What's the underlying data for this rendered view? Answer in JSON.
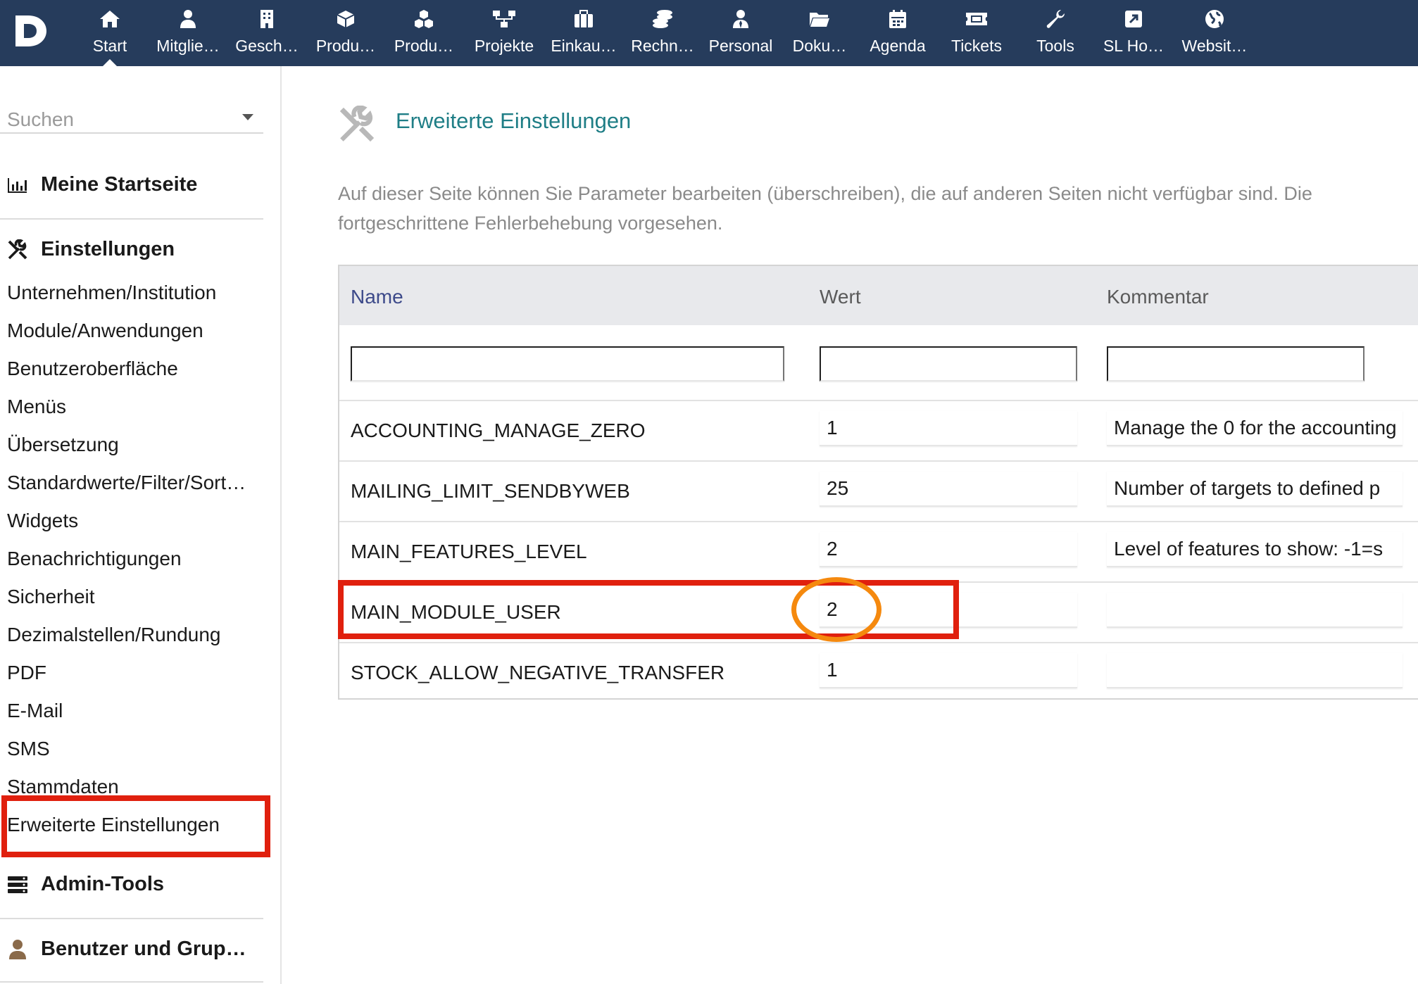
{
  "topbar": {
    "logo_icon": "dolibarr-d-logo",
    "items": [
      {
        "label": "Start",
        "icon": "home-icon"
      },
      {
        "label": "Mitglie…",
        "icon": "member-icon"
      },
      {
        "label": "Gesch…",
        "icon": "building-icon"
      },
      {
        "label": "Produ…",
        "icon": "cube-icon"
      },
      {
        "label": "Produ…",
        "icon": "cubes-icon"
      },
      {
        "label": "Projekte",
        "icon": "project-icon"
      },
      {
        "label": "Einkau…",
        "icon": "briefcase-icon"
      },
      {
        "label": "Rechn…",
        "icon": "coins-icon"
      },
      {
        "label": "Personal",
        "icon": "user-tie-icon"
      },
      {
        "label": "Doku…",
        "icon": "folder-icon"
      },
      {
        "label": "Agenda",
        "icon": "calendar-icon"
      },
      {
        "label": "Tickets",
        "icon": "ticket-icon"
      },
      {
        "label": "Tools",
        "icon": "wrench-icon"
      },
      {
        "label": "SL Ho…",
        "icon": "external-link-icon"
      },
      {
        "label": "Websit…",
        "icon": "globe-icon"
      }
    ],
    "active_index": 0
  },
  "sidebar": {
    "search_placeholder": "Suchen",
    "home_label": "Meine Startseite",
    "settings_label": "Einstellungen",
    "items": [
      "Unternehmen/Institution",
      "Module/Anwendungen",
      "Benutzeroberfläche",
      "Menüs",
      "Übersetzung",
      "Standardwerte/Filter/Sort…",
      "Widgets",
      "Benachrichtigungen",
      "Sicherheit",
      "Dezimalstellen/Rundung",
      "PDF",
      "E-Mail",
      "SMS",
      "Stammdaten",
      "Erweiterte Einstellungen"
    ],
    "admin_tools_label": "Admin-Tools",
    "users_groups_label": "Benutzer und Grup…"
  },
  "main": {
    "title": "Erweiterte Einstellungen",
    "description_line1": "Auf dieser Seite können Sie Parameter bearbeiten (überschreiben), die auf anderen Seiten nicht verfügbar sind. Die",
    "description_line2": "fortgeschrittene Fehlerbehebung vorgesehen.",
    "table": {
      "headers": {
        "name": "Name",
        "value": "Wert",
        "comment": "Kommentar"
      },
      "rows": [
        {
          "name": "ACCOUNTING_MANAGE_ZERO",
          "value": "1",
          "comment": "Manage the  0 for the accounting"
        },
        {
          "name": "MAILING_LIMIT_SENDBYWEB",
          "value": "25",
          "comment": "Number of targets to defined p"
        },
        {
          "name": "MAIN_FEATURES_LEVEL",
          "value": "2",
          "comment": "Level of features to show: -1=s"
        },
        {
          "name": "MAIN_MODULE_USER",
          "value": "2",
          "comment": ""
        },
        {
          "name": "STOCK_ALLOW_NEGATIVE_TRANSFER",
          "value": "1",
          "comment": ""
        }
      ]
    }
  },
  "colors": {
    "topbar_bg": "#263c5c",
    "title_teal": "#1f7e86",
    "highlight_red": "#e0200e",
    "highlight_orange": "#f5890e"
  }
}
